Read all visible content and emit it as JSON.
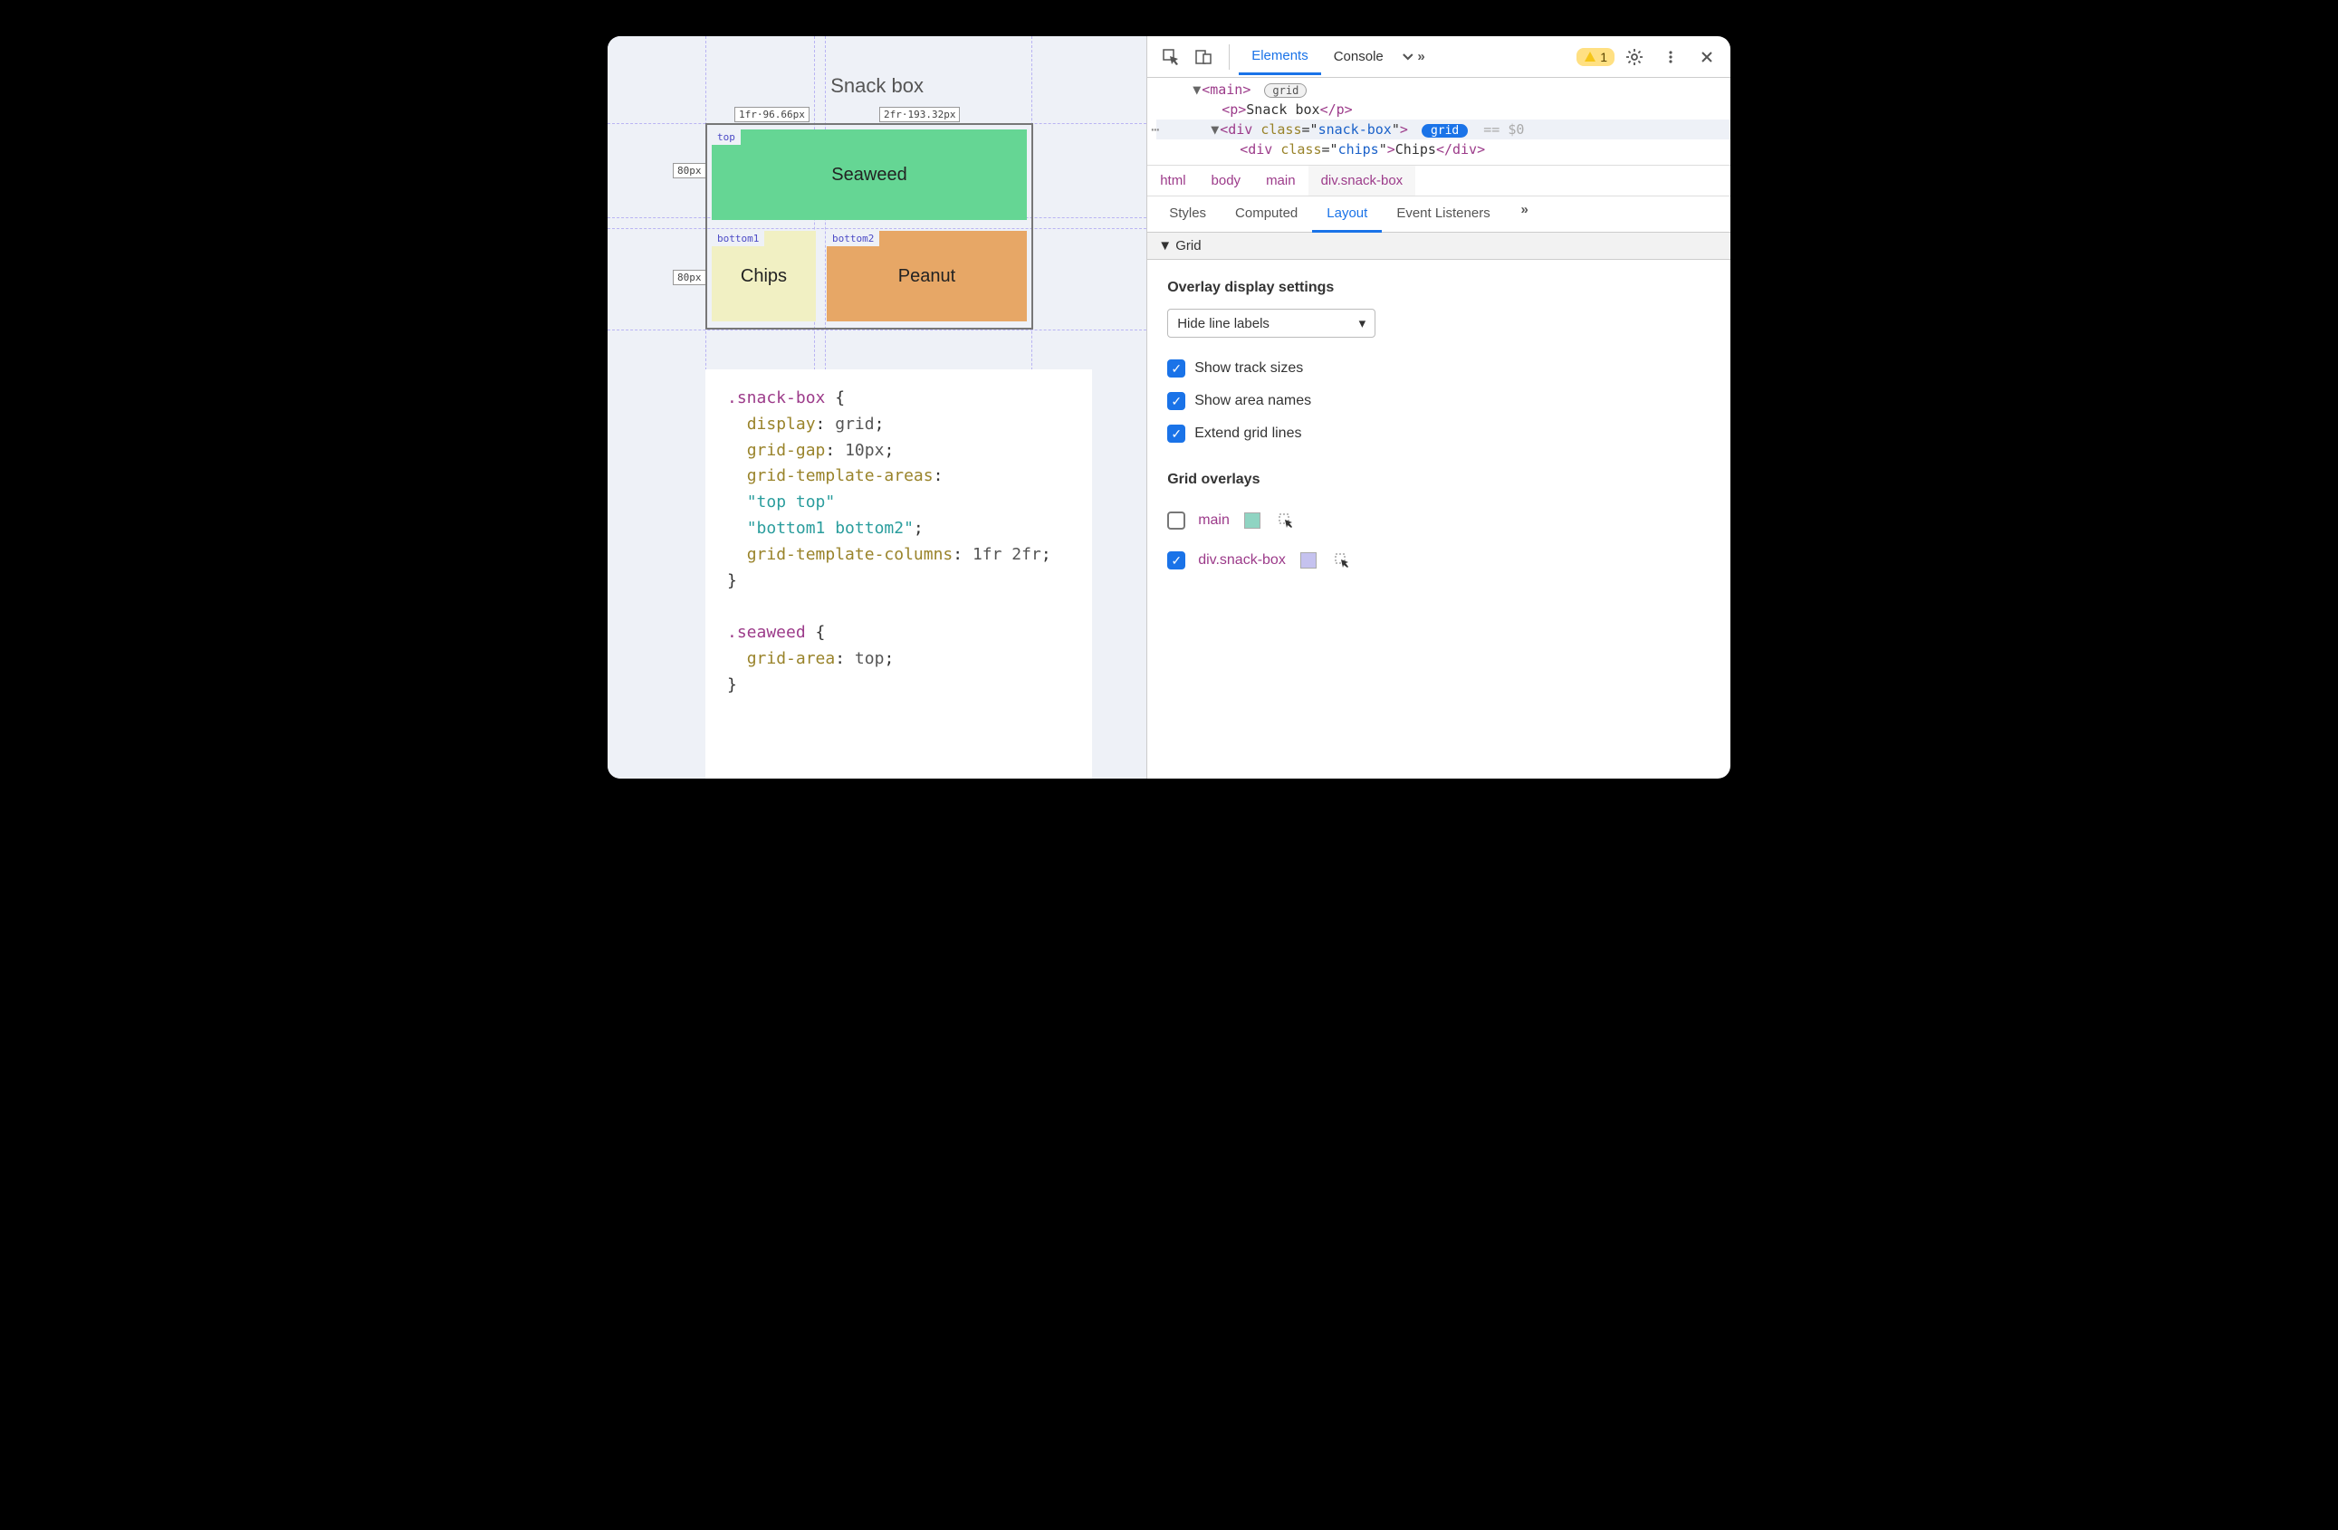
{
  "page": {
    "title": "Snack box",
    "tracks": {
      "col1": "1fr·96.66px",
      "col2": "2fr·193.32px",
      "row": "80px"
    },
    "areas": {
      "top": "top",
      "b1": "bottom1",
      "b2": "bottom2"
    },
    "tiles": {
      "seaweed": "Seaweed",
      "chips": "Chips",
      "peanut": "Peanut"
    },
    "css": {
      "sel1": ".snack-box",
      "p1": "display",
      "v1": "grid",
      "p2": "grid-gap",
      "v2": "10px",
      "p3": "grid-template-areas",
      "s1": "\"top top\"",
      "s2": "\"bottom1 bottom2\"",
      "p4": "grid-template-columns",
      "v4": "1fr 2fr",
      "sel2": ".seaweed",
      "p5": "grid-area",
      "v5": "top"
    }
  },
  "devtools": {
    "toolbar": {
      "tabElements": "Elements",
      "tabConsole": "Console",
      "warnCount": "1"
    },
    "dom": {
      "l1_open": "<main>",
      "grid_word": "grid",
      "l2": "<p>Snack box</p>",
      "l3_open": "<div class=\"snack-box\">",
      "dollar": "== $0",
      "l4": "<div class=\"chips\">Chips</div>"
    },
    "breadcrumb": {
      "html": "html",
      "body": "body",
      "main": "main",
      "sel": "div.snack-box"
    },
    "subtabs": {
      "styles": "Styles",
      "computed": "Computed",
      "layout": "Layout",
      "events": "Event Listeners"
    },
    "layout": {
      "grid_header": "Grid",
      "group1": "Overlay display settings",
      "dropdown": "Hide line labels",
      "cb1": "Show track sizes",
      "cb2": "Show area names",
      "cb3": "Extend grid lines",
      "group2": "Grid overlays",
      "ov1": "main",
      "ov2": "div.snack-box"
    }
  }
}
